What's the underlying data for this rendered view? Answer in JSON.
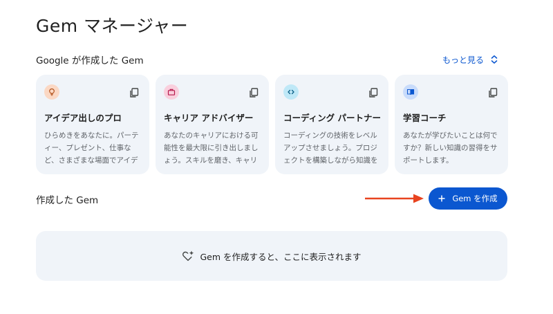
{
  "header": {
    "title": "Gem マネージャー"
  },
  "premade": {
    "section_title": "Google が作成した Gem",
    "show_more_label": "もっと見る",
    "cards": [
      {
        "title": "アイデア出しのプロ",
        "description": "ひらめきをあなたに。パーティー、プレゼント、仕事など、さまざまな場面でアイデアを提…",
        "icon": "lightbulb-icon",
        "icon_bg": "#fbd8c4",
        "icon_color": "#b3541e"
      },
      {
        "title": "キャリア アドバイザー",
        "description": "あなたのキャリアにおける可能性を最大限に引き出しましょう。スキルを磨き、キャリア…",
        "icon": "briefcase-icon",
        "icon_bg": "#f9cfdd",
        "icon_color": "#b5174b"
      },
      {
        "title": "コーディング パートナー",
        "description": "コーディングの技術をレベルアップさせましょう。プロジェクトを構築しながら知識を深め…",
        "icon": "code-icon",
        "icon_bg": "#bfe8f7",
        "icon_color": "#0a5f86"
      },
      {
        "title": "学習コーチ",
        "description": "あなたが学びたいことは何ですか？新しい知識の習得をサポートします。",
        "icon": "book-icon",
        "icon_bg": "#c9dcfb",
        "icon_color": "#0b57d0"
      }
    ]
  },
  "my_gems": {
    "section_title": "作成した Gem",
    "create_button_label": "Gem を作成",
    "empty_message": "Gem を作成すると、ここに表示されます"
  },
  "colors": {
    "accent": "#0b57d0",
    "card_bg": "#f0f4f9",
    "arrow": "#e8431f"
  }
}
